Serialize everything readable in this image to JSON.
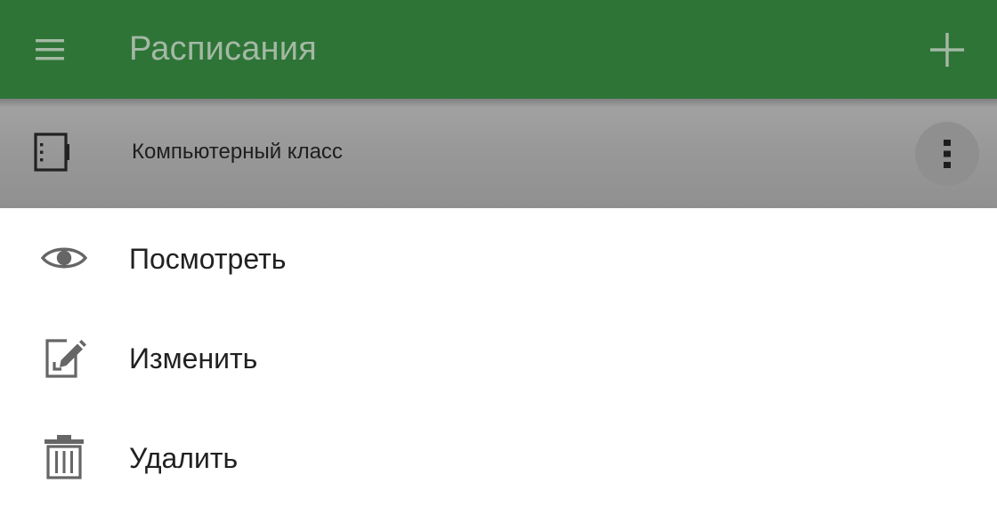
{
  "app_bar": {
    "title": "Расписания",
    "menu_icon": "menu-icon",
    "add_icon": "add-icon",
    "background": "#2e7437",
    "title_color": "#a4b9a4"
  },
  "list": {
    "items": [
      {
        "label": "Компьютерный класс",
        "icon": "device-icon",
        "more_icon": "more-vertical-icon"
      }
    ]
  },
  "bottom_sheet": {
    "items": [
      {
        "label": "Посмотреть",
        "icon": "eye-icon"
      },
      {
        "label": "Изменить",
        "icon": "edit-icon"
      },
      {
        "label": "Удалить",
        "icon": "trash-icon"
      }
    ]
  }
}
